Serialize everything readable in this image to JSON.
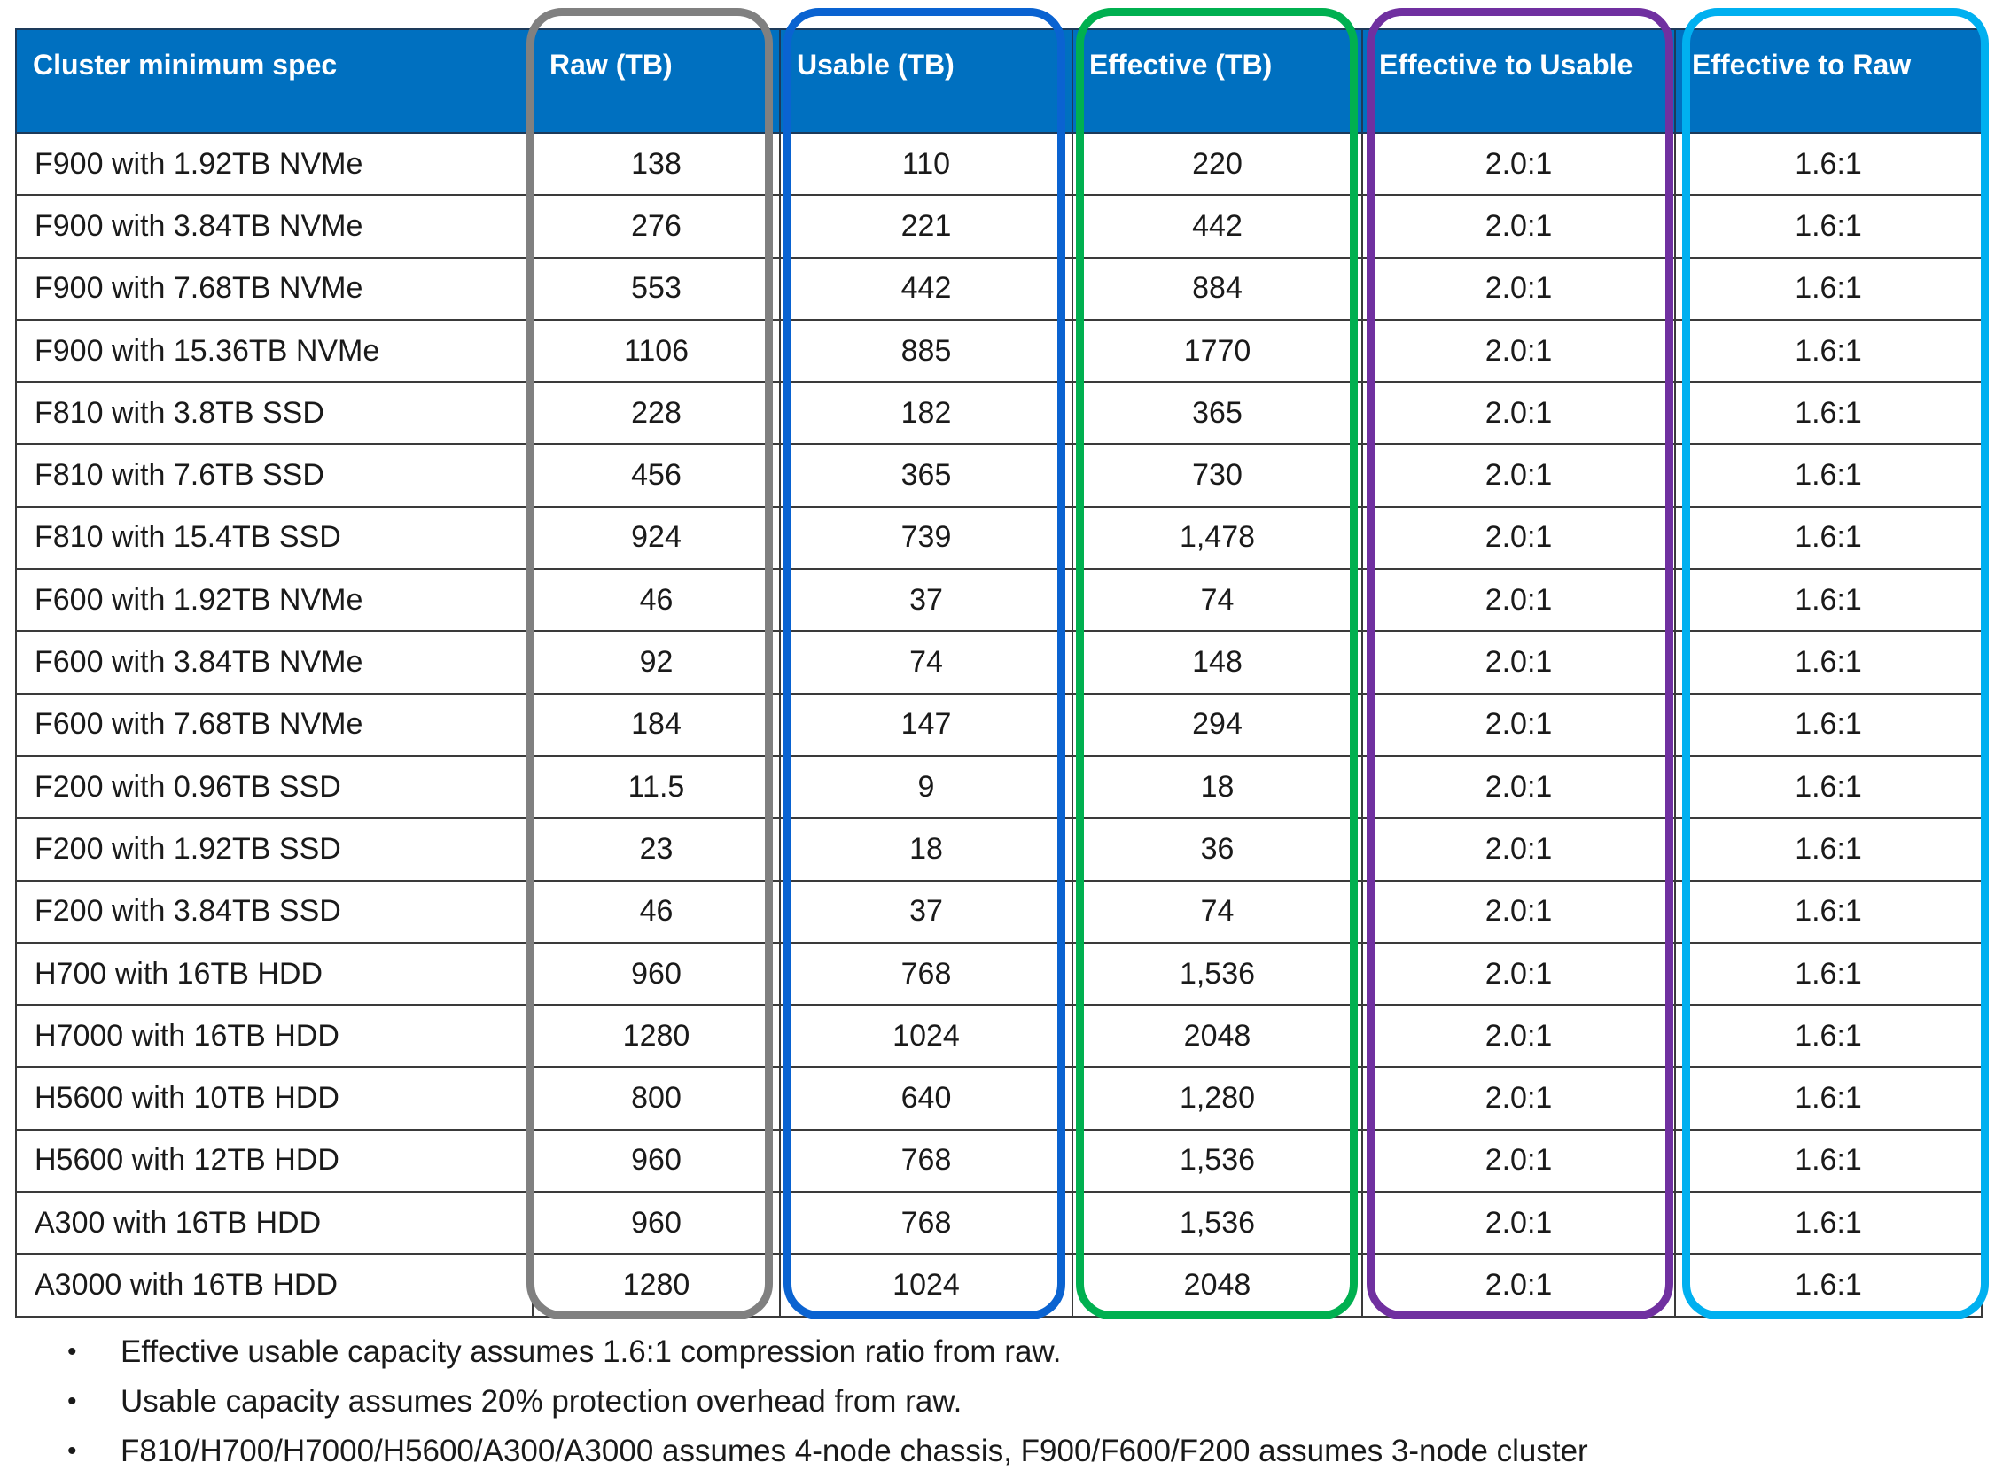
{
  "table": {
    "headers": [
      "Cluster minimum spec",
      "Raw (TB)",
      "Usable (TB)",
      "Effective (TB)",
      "Effective to Usable",
      "Effective to Raw"
    ],
    "rows": [
      [
        "F900 with 1.92TB NVMe",
        "138",
        "110",
        "220",
        "2.0:1",
        "1.6:1"
      ],
      [
        "F900 with 3.84TB NVMe",
        "276",
        "221",
        "442",
        "2.0:1",
        "1.6:1"
      ],
      [
        "F900 with 7.68TB NVMe",
        "553",
        "442",
        "884",
        "2.0:1",
        "1.6:1"
      ],
      [
        "F900 with 15.36TB NVMe",
        "1106",
        "885",
        "1770",
        "2.0:1",
        "1.6:1"
      ],
      [
        "F810 with 3.8TB SSD",
        "228",
        "182",
        "365",
        "2.0:1",
        "1.6:1"
      ],
      [
        "F810 with 7.6TB SSD",
        "456",
        "365",
        "730",
        "2.0:1",
        "1.6:1"
      ],
      [
        "F810 with 15.4TB SSD",
        "924",
        "739",
        "1,478",
        "2.0:1",
        "1.6:1"
      ],
      [
        "F600 with 1.92TB NVMe",
        "46",
        "37",
        "74",
        "2.0:1",
        "1.6:1"
      ],
      [
        "F600 with 3.84TB NVMe",
        "92",
        "74",
        "148",
        "2.0:1",
        "1.6:1"
      ],
      [
        "F600 with 7.68TB NVMe",
        "184",
        "147",
        "294",
        "2.0:1",
        "1.6:1"
      ],
      [
        "F200 with 0.96TB SSD",
        "11.5",
        "9",
        "18",
        "2.0:1",
        "1.6:1"
      ],
      [
        "F200 with 1.92TB SSD",
        "23",
        "18",
        "36",
        "2.0:1",
        "1.6:1"
      ],
      [
        "F200 with 3.84TB SSD",
        "46",
        "37",
        "74",
        "2.0:1",
        "1.6:1"
      ],
      [
        "H700 with 16TB HDD",
        "960",
        "768",
        "1,536",
        "2.0:1",
        "1.6:1"
      ],
      [
        "H7000 with 16TB HDD",
        "1280",
        "1024",
        "2048",
        "2.0:1",
        "1.6:1"
      ],
      [
        "H5600 with 10TB HDD",
        "800",
        "640",
        "1,280",
        "2.0:1",
        "1.6:1"
      ],
      [
        "H5600 with 12TB HDD",
        "960",
        "768",
        "1,536",
        "2.0:1",
        "1.6:1"
      ],
      [
        "A300 with 16TB HDD",
        "960",
        "768",
        "1,536",
        "2.0:1",
        "1.6:1"
      ],
      [
        "A3000 with 16TB HDD",
        "1280",
        "1024",
        "2048",
        "2.0:1",
        "1.6:1"
      ]
    ]
  },
  "highlight_colors": {
    "raw": "#808080",
    "usable": "#0a63d1",
    "effective": "#00b050",
    "effective_to_usable": "#7030a0",
    "effective_to_raw": "#00b0f0"
  },
  "header_color": "#0070c0",
  "notes": {
    "bullet": "•",
    "items": [
      "Effective usable capacity assumes 1.6:1 compression ratio from raw.",
      "Usable capacity assumes 20% protection overhead from raw.",
      "F810/H700/H7000/H5600/A300/A3000 assumes 4-node chassis, F900/F600/F200 assumes 3-node cluster"
    ]
  }
}
